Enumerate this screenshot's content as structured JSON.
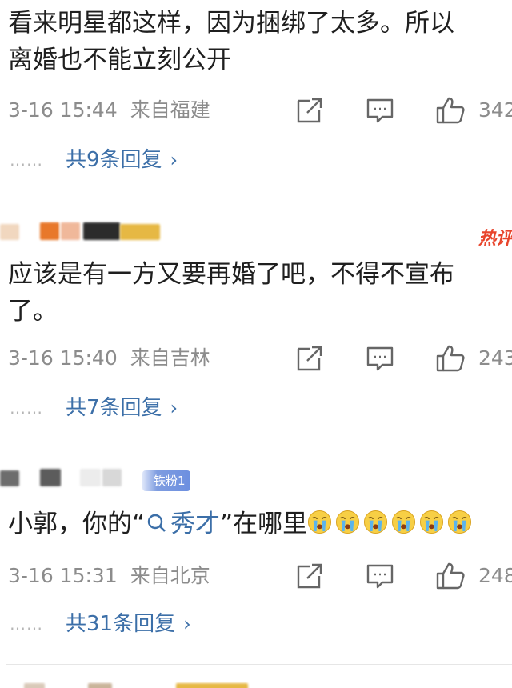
{
  "comments": [
    {
      "text_lines": [
        "看来明星都这样，因为捆绑了太多。所以",
        "离婚也不能立刻公开"
      ],
      "time": "3-16 15:44",
      "location": "来自福建",
      "likes": "342",
      "replies": "共9条回复"
    },
    {
      "hot_badge": "热评",
      "text_lines": [
        "应该是有一方又要再婚了吧，不得不宣布",
        "了。"
      ],
      "time": "3-16 15:40",
      "location": "来自吉林",
      "likes": "243",
      "replies": "共7条回复"
    },
    {
      "fan_badge": "铁粉1",
      "text_before": "小郭，你的“",
      "topic": "秀才",
      "text_after": "”在哪里",
      "emoji_count": 6,
      "time": "3-16 15:31",
      "location": "来自北京",
      "likes": "248",
      "replies": "共31条回复"
    }
  ],
  "reply_dots": "……",
  "reply_chevron": "›",
  "colors": {
    "link": "#3c6fa8",
    "meta": "#8c8c8c",
    "hot": "#e8452c",
    "divider": "#e6e6e6"
  },
  "icons": [
    "share-icon",
    "comment-icon",
    "like-icon",
    "search-icon",
    "crying-emoji-icon"
  ]
}
